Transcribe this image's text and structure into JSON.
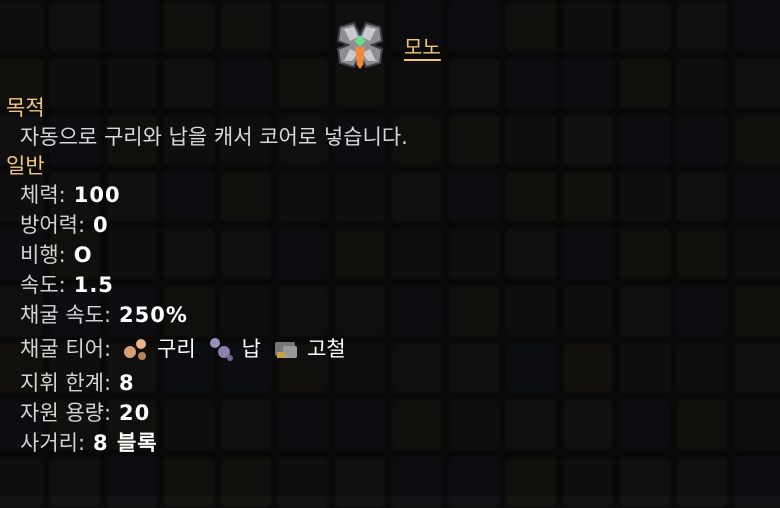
{
  "unit": {
    "name": "모노",
    "icon": "mono-unit-icon"
  },
  "purpose": {
    "heading": "목적",
    "description": "자동으로 구리와 납을 캐서 코어로 넣습니다."
  },
  "general": {
    "heading": "일반",
    "health": {
      "label": "체력:",
      "value": "100"
    },
    "armor": {
      "label": "방어력:",
      "value": "0"
    },
    "flying": {
      "label": "비행:",
      "value": "O"
    },
    "speed": {
      "label": "속도:",
      "value": "1.5"
    },
    "mine_speed": {
      "label": "채굴 속도:",
      "value": "250%"
    },
    "mine_tier": {
      "label": "채굴 티어:",
      "ores": [
        {
          "name": "구리",
          "icon": "copper-ore-icon",
          "color": "#d99d73"
        },
        {
          "name": "납",
          "icon": "lead-ore-icon",
          "color": "#8c7fa9"
        },
        {
          "name": "고철",
          "icon": "scrap-ore-icon",
          "color": "#777777"
        }
      ]
    },
    "command_limit": {
      "label": "지휘 한계:",
      "value": "8"
    },
    "item_capacity": {
      "label": "자원 용량:",
      "value": "20"
    },
    "range": {
      "label": "사거리:",
      "value": "8 블록"
    }
  }
}
